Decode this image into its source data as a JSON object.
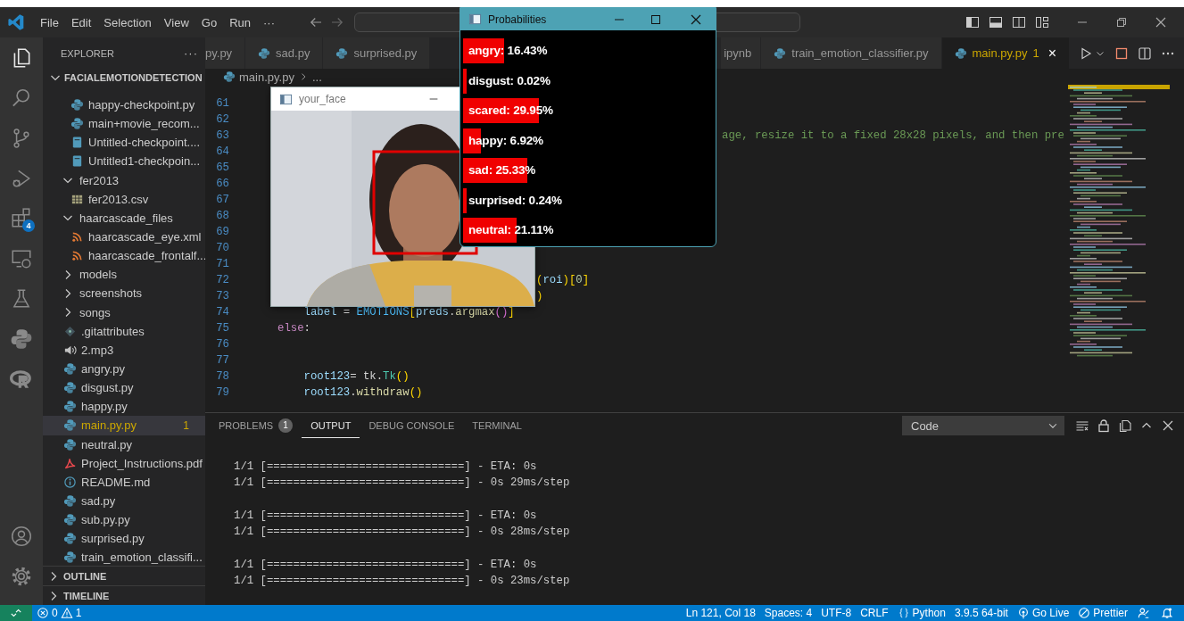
{
  "titlebar": {
    "menu": [
      "File",
      "Edit",
      "Selection",
      "View",
      "Go",
      "Run",
      "···"
    ]
  },
  "activity_bar": {
    "top": [
      {
        "kind": "explorer",
        "selected": true
      },
      {
        "kind": "search",
        "selected": false
      },
      {
        "kind": "source-control",
        "selected": false
      },
      {
        "kind": "run-debug",
        "selected": false
      },
      {
        "kind": "extensions",
        "selected": false,
        "badge": "4"
      },
      {
        "kind": "remote",
        "selected": false
      },
      {
        "kind": "testing",
        "selected": false
      },
      {
        "kind": "python",
        "selected": false
      },
      {
        "kind": "r",
        "selected": false
      }
    ],
    "bottom": [
      {
        "kind": "account"
      },
      {
        "kind": "settings"
      }
    ]
  },
  "sidebar": {
    "title": "EXPLORER",
    "more": "···",
    "root": {
      "label": "FACIALEMOTIONDETECTION",
      "expanded": true,
      "children": [
        {
          "kind": "folder-scrolled",
          "children": [
            {
              "kind": "python",
              "label": "happy-checkpoint.py",
              "selected": false
            },
            {
              "kind": "python",
              "label": "main+movie_recom...",
              "selected": false
            },
            {
              "kind": "notebook",
              "label": "Untitled-checkpoint....",
              "selected": false
            },
            {
              "kind": "notebook",
              "label": "Untitled1-checkpoin...",
              "selected": false
            }
          ]
        },
        {
          "kind": "folder",
          "label": "fer2013",
          "expanded": true,
          "selected": false,
          "children": [
            {
              "kind": "csv",
              "label": "fer2013.csv",
              "selected": false
            }
          ]
        },
        {
          "kind": "folder",
          "label": "haarcascade_files",
          "expanded": true,
          "selected": false,
          "children": [
            {
              "kind": "xml",
              "label": "haarcascade_eye.xml",
              "selected": false
            },
            {
              "kind": "xml",
              "label": "haarcascade_frontalf...",
              "selected": false
            }
          ]
        },
        {
          "kind": "folder",
          "label": "models",
          "expanded": false,
          "selected": false
        },
        {
          "kind": "folder",
          "label": "screenshots",
          "expanded": false,
          "selected": false
        },
        {
          "kind": "folder",
          "label": "songs",
          "expanded": false,
          "selected": false
        },
        {
          "kind": "git",
          "label": ".gitattributes",
          "selected": false
        },
        {
          "kind": "audio",
          "label": "2.mp3",
          "selected": false
        },
        {
          "kind": "python",
          "label": "angry.py",
          "selected": false
        },
        {
          "kind": "python",
          "label": "disgust.py",
          "selected": false
        },
        {
          "kind": "python",
          "label": "happy.py",
          "selected": false
        },
        {
          "kind": "python",
          "label": "main.py.py",
          "selected": true,
          "problems": "1"
        },
        {
          "kind": "python",
          "label": "neutral.py",
          "selected": false
        },
        {
          "kind": "pdf",
          "label": "Project_Instructions.pdf",
          "selected": false
        },
        {
          "kind": "info",
          "label": "README.md",
          "selected": false
        },
        {
          "kind": "python",
          "label": "sad.py",
          "selected": false
        },
        {
          "kind": "python",
          "label": "sub.py.py",
          "selected": false
        },
        {
          "kind": "python",
          "label": "surprised.py",
          "selected": false
        },
        {
          "kind": "python",
          "label": "train_emotion_classifi...",
          "selected": false
        }
      ]
    },
    "sections": [
      {
        "label": "OUTLINE",
        "expanded": false
      },
      {
        "label": "TIMELINE",
        "expanded": false
      }
    ]
  },
  "editor": {
    "tabs": [
      {
        "label": "py.py",
        "selected": false
      },
      {
        "kind": "python",
        "label": "sad.py",
        "selected": false
      },
      {
        "kind": "python",
        "label": "surprised.py",
        "selected": false
      },
      {
        "label": "ipynb",
        "selected": false
      },
      {
        "kind": "python",
        "label": "train_emotion_classifier.py",
        "selected": false
      },
      {
        "kind": "python",
        "label": "main.py.py",
        "selected": true,
        "problems": "1",
        "close": "×"
      }
    ],
    "breadcrumb": [
      "main.py.py",
      "..."
    ],
    "lines": [
      {
        "number": "61"
      },
      {
        "number": "62"
      },
      {
        "number": "63",
        "tokens": [
          {
            "text": "age, resize it to a fixed 28x28 pixels, and then pre",
            "kind": "comment"
          }
        ]
      },
      {
        "number": "64"
      },
      {
        "number": "65"
      },
      {
        "number": "66"
      },
      {
        "number": "67"
      },
      {
        "number": "68"
      },
      {
        "number": "69"
      },
      {
        "number": "70"
      },
      {
        "number": "71"
      },
      {
        "number": "72",
        "tokens": [
          {
            "text": "(",
            "kind": "bracket"
          },
          {
            "text": "roi",
            "kind": "variable"
          },
          {
            "text": ")[",
            "kind": "bracket"
          },
          {
            "text": "0",
            "kind": "number"
          },
          {
            "text": "]",
            "kind": "bracket"
          }
        ]
      },
      {
        "number": "73",
        "tokens": [
          {
            "text": ")",
            "kind": "bracket"
          }
        ]
      },
      {
        "number": "74",
        "tokens": [
          {
            "text": "    label",
            "kind": "variable"
          },
          {
            "text": " = ",
            "kind": "plain"
          },
          {
            "text": "EMOTIONS",
            "kind": "constant"
          },
          {
            "text": "[",
            "kind": "bracket"
          },
          {
            "text": "preds",
            "kind": "variable"
          },
          {
            "text": ".",
            "kind": "plain"
          },
          {
            "text": "argmax",
            "kind": "function"
          },
          {
            "text": "()",
            "kind": "bracket2"
          },
          {
            "text": "]",
            "kind": "bracket"
          }
        ]
      },
      {
        "number": "75",
        "tokens": [
          {
            "text": "else",
            "kind": "keyword"
          },
          {
            "text": ":",
            "kind": "plain"
          }
        ]
      },
      {
        "number": "76"
      },
      {
        "number": "77"
      },
      {
        "number": "78",
        "tokens": [
          {
            "text": "    root123",
            "kind": "variable"
          },
          {
            "text": "= tk.",
            "kind": "plain"
          },
          {
            "text": "Tk",
            "kind": "class"
          },
          {
            "text": "()",
            "kind": "bracket"
          }
        ]
      },
      {
        "number": "79",
        "tokens": [
          {
            "text": "    root123",
            "kind": "variable"
          },
          {
            "text": ".",
            "kind": "plain"
          },
          {
            "text": "withdraw",
            "kind": "function"
          },
          {
            "text": "()",
            "kind": "bracket"
          }
        ]
      }
    ]
  },
  "panel": {
    "tabs": [
      {
        "label": "PROBLEMS",
        "badge": "1",
        "selected": false
      },
      {
        "label": "OUTPUT",
        "selected": true
      },
      {
        "label": "DEBUG CONSOLE",
        "selected": false
      },
      {
        "label": "TERMINAL",
        "selected": false
      }
    ],
    "channel": "Code",
    "output": [
      [
        "1/1 [==============================] - ETA: 0s",
        "1/1 [==============================] - 0s 29ms/step"
      ],
      [
        "1/1 [==============================] - ETA: 0s",
        "1/1 [==============================] - 0s 28ms/step"
      ],
      [
        "1/1 [==============================] - ETA: 0s",
        "1/1 [==============================] - 0s 23ms/step"
      ]
    ]
  },
  "status_bar": {
    "errors": "0",
    "warnings": "1",
    "items": [
      {
        "kind": "text",
        "text": "Ln 121, Col 18"
      },
      {
        "kind": "text",
        "text": "Spaces: 4"
      },
      {
        "kind": "text",
        "text": "UTF-8"
      },
      {
        "kind": "text",
        "text": "CRLF"
      },
      {
        "kind": "language",
        "text": "Python"
      },
      {
        "kind": "text",
        "text": "3.9.5 64-bit"
      },
      {
        "kind": "live",
        "text": "Go Live"
      },
      {
        "kind": "prettier",
        "text": "Prettier"
      },
      {
        "kind": "feedback"
      },
      {
        "kind": "bell"
      }
    ]
  },
  "face_window": {
    "title": "your_face"
  },
  "probabilities_window": {
    "title": "Probabilities",
    "rows": [
      {
        "label": "angry: 16.43%",
        "level": 0.1643
      },
      {
        "label": "disgust: 0.02%",
        "level": 0.0002
      },
      {
        "label": "scared: 29.95%",
        "level": 0.2995
      },
      {
        "label": "happy: 6.92%",
        "level": 0.0692
      },
      {
        "label": "sad: 25.33%",
        "level": 0.2533
      },
      {
        "label": "surprised: 0.24%",
        "level": 0.0024
      },
      {
        "label": "neutral: 21.11%",
        "level": 0.2111
      }
    ]
  }
}
